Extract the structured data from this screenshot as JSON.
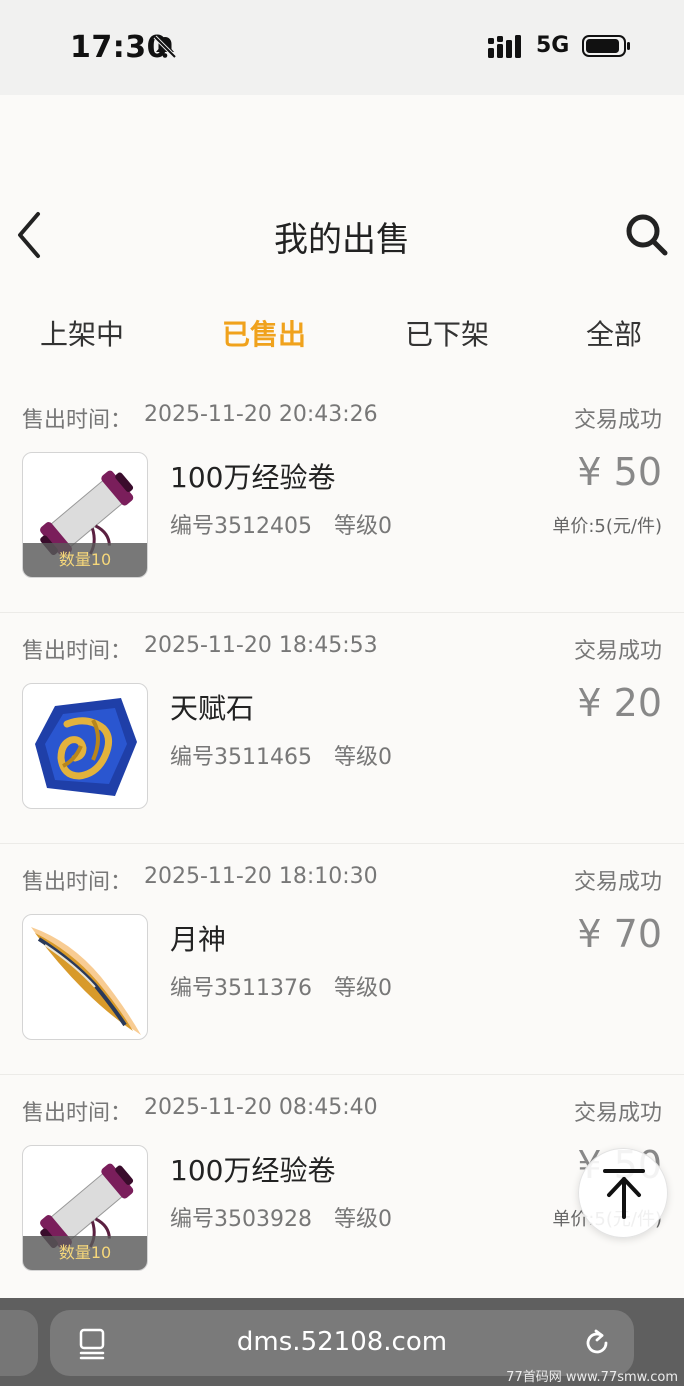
{
  "status_bar": {
    "time": "17:30",
    "network": "5G"
  },
  "header": {
    "title": "我的出售"
  },
  "tabs": [
    {
      "label": "上架中",
      "active": false
    },
    {
      "label": "已售出",
      "active": true
    },
    {
      "label": "已下架",
      "active": false
    },
    {
      "label": "全部",
      "active": false
    }
  ],
  "orders": [
    {
      "time_label": "售出时间：",
      "time": "2025-11-20 20:43:26",
      "status": "交易成功",
      "name": "100万经验卷",
      "serial": "编号3512405",
      "level": "等级0",
      "price": "¥ 50",
      "unit_price": "单价:5(元/件)",
      "quantity": "数量10",
      "icon": "scroll-icon"
    },
    {
      "time_label": "售出时间：",
      "time": "2025-11-20 18:45:53",
      "status": "交易成功",
      "name": "天赋石",
      "serial": "编号3511465",
      "level": "等级0",
      "price": "¥ 20",
      "icon": "gem-icon"
    },
    {
      "time_label": "售出时间：",
      "time": "2025-11-20 18:10:30",
      "status": "交易成功",
      "name": "月神",
      "serial": "编号3511376",
      "level": "等级0",
      "price": "¥ 70",
      "icon": "blade-icon"
    },
    {
      "time_label": "售出时间：",
      "time": "2025-11-20 08:45:40",
      "status": "交易成功",
      "name": "100万经验卷",
      "serial": "编号3503928",
      "level": "等级0",
      "price": "¥ 50",
      "unit_price": "单价:5(元/件)",
      "quantity": "数量10",
      "icon": "scroll-icon"
    }
  ],
  "browser": {
    "url": "dms.52108.com",
    "watermark": "77首码网 www.77smw.com"
  },
  "colors": {
    "accent": "#f0a21c",
    "muted_text": "#777777",
    "background": "#fbfaf8"
  }
}
